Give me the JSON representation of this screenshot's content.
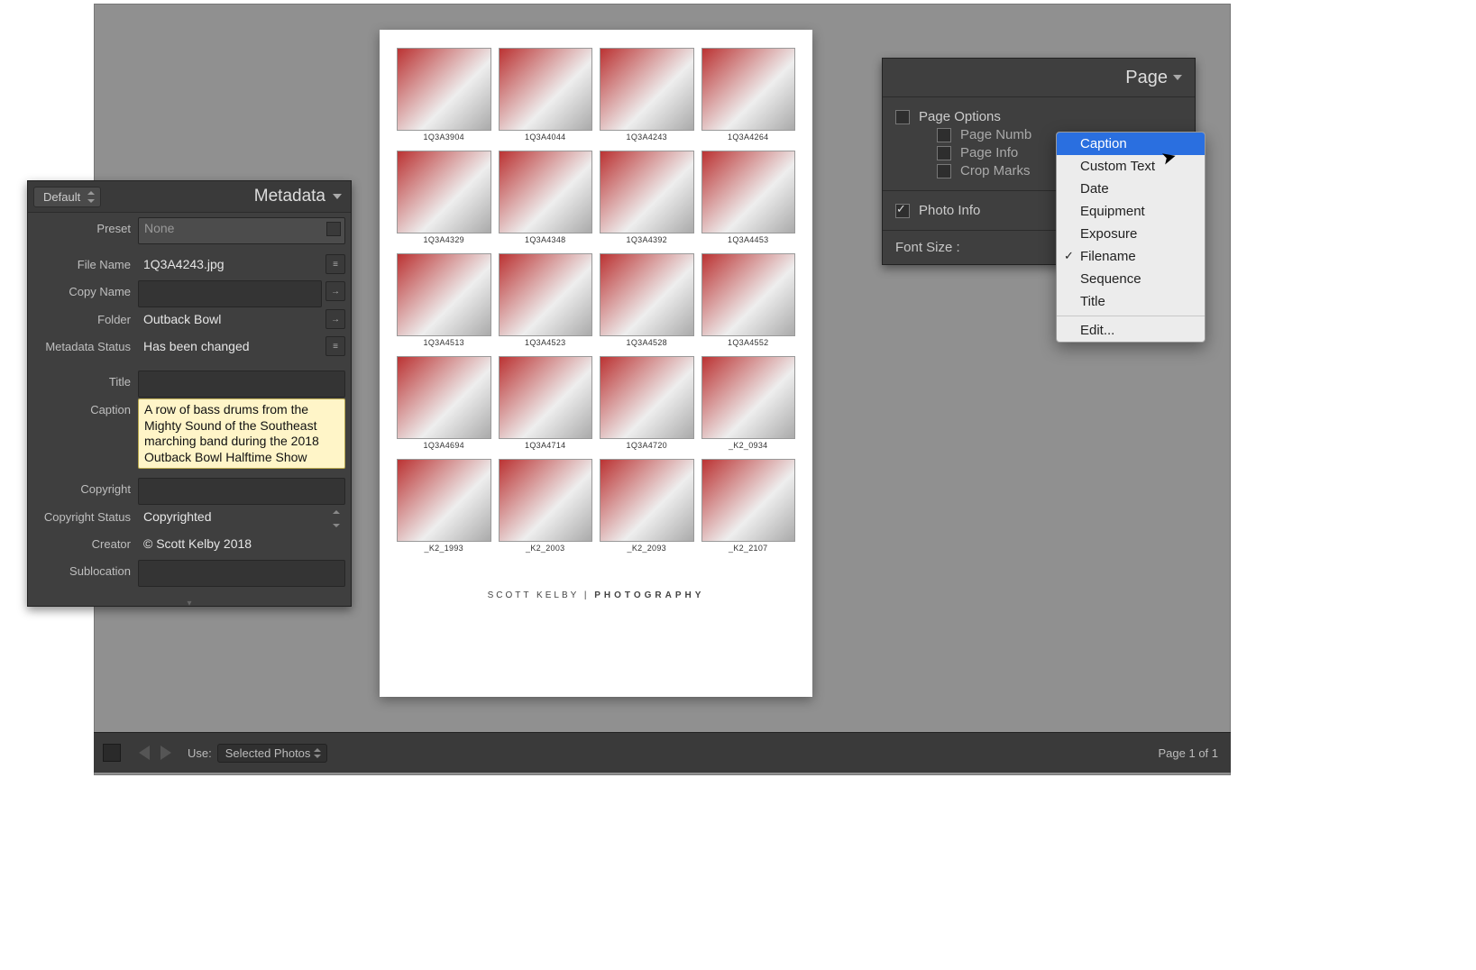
{
  "canvas": {
    "footer_brand": "SCOTT KELBY",
    "footer_sep": " | ",
    "footer_photo": "PHOTOGRAPHY",
    "thumbs": [
      "1Q3A3904",
      "1Q3A4044",
      "1Q3A4243",
      "1Q3A4264",
      "1Q3A4329",
      "1Q3A4348",
      "1Q3A4392",
      "1Q3A4453",
      "1Q3A4513",
      "1Q3A4523",
      "1Q3A4528",
      "1Q3A4552",
      "1Q3A4694",
      "1Q3A4714",
      "1Q3A4720",
      "_K2_0934",
      "_K2_1993",
      "_K2_2003",
      "_K2_2093",
      "_K2_2107"
    ]
  },
  "bottombar": {
    "use_label": "Use:",
    "use_value": "Selected Photos",
    "page_status": "Page 1 of 1"
  },
  "metadata": {
    "panel_title": "Metadata",
    "default_dd": "Default",
    "preset_label": "Preset",
    "preset_value": "None",
    "filename_label": "File Name",
    "filename_value": "1Q3A4243.jpg",
    "copyname_label": "Copy Name",
    "copyname_value": "",
    "folder_label": "Folder",
    "folder_value": "Outback Bowl",
    "status_label": "Metadata Status",
    "status_value": "Has been changed",
    "title_label": "Title",
    "title_value": "",
    "caption_label": "Caption",
    "caption_value": "A row of bass drums from the Mighty Sound of the Southeast marching band during the 2018 Outback Bowl Halftime Show",
    "copyright_label": "Copyright",
    "copyright_value": "",
    "copyright_status_label": "Copyright Status",
    "copyright_status_value": "Copyrighted",
    "creator_label": "Creator",
    "creator_value": "© Scott Kelby 2018",
    "sublocation_label": "Sublocation",
    "sublocation_value": ""
  },
  "page_panel": {
    "title": "Page",
    "page_options_label": "Page Options",
    "page_numbers_label": "Page Numb",
    "page_info_label": "Page Info",
    "crop_marks_label": "Crop Marks",
    "photo_info_label": "Photo Info",
    "font_size_label": "Font Size :"
  },
  "ctx_menu": {
    "items": [
      {
        "label": "Caption",
        "highlight": true,
        "checked": false
      },
      {
        "label": "Custom Text",
        "highlight": false,
        "checked": false
      },
      {
        "label": "Date",
        "highlight": false,
        "checked": false
      },
      {
        "label": "Equipment",
        "highlight": false,
        "checked": false
      },
      {
        "label": "Exposure",
        "highlight": false,
        "checked": false
      },
      {
        "label": "Filename",
        "highlight": false,
        "checked": true
      },
      {
        "label": "Sequence",
        "highlight": false,
        "checked": false
      },
      {
        "label": "Title",
        "highlight": false,
        "checked": false
      }
    ],
    "edit_label": "Edit..."
  }
}
